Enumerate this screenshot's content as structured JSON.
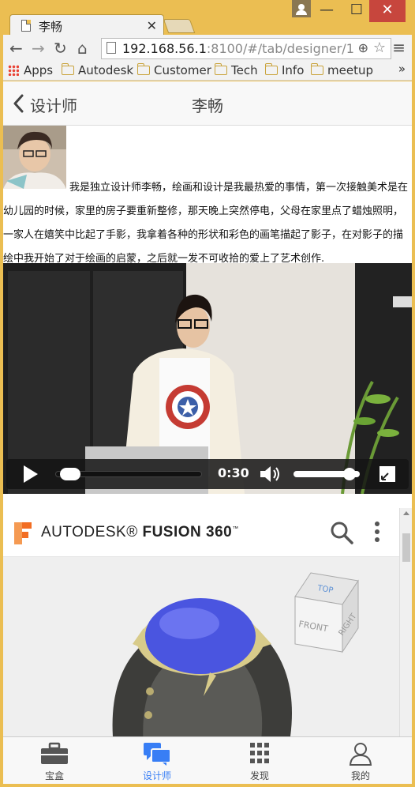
{
  "browser": {
    "tab_title": "李畅",
    "url_host": "192.168.56.1",
    "url_rest": ":8100/#/tab/designer/1",
    "window_controls": {
      "minimize": "—",
      "maximize": "☐",
      "close": "✕"
    },
    "bookmarks": [
      {
        "label": "Apps",
        "icon": "apps-grid-icon"
      },
      {
        "label": "Autodesk",
        "icon": "folder-icon"
      },
      {
        "label": "Customer",
        "icon": "folder-icon"
      },
      {
        "label": "Tech",
        "icon": "folder-icon"
      },
      {
        "label": "Info",
        "icon": "folder-icon"
      },
      {
        "label": "meetup",
        "icon": "folder-icon"
      }
    ],
    "bookmarks_more": "»"
  },
  "header": {
    "back_label": "设计师",
    "title": "李畅"
  },
  "designer": {
    "bio": "我是独立设计师李畅，绘画和设计是我最热爱的事情，第一次接触美术是在幼儿园的时候，家里的房子要重新整修，那天晚上突然停电，父母在家里点了蜡烛照明，一家人在嬉笑中比起了手影，我拿着各种的形状和彩色的画笔描起了影子，在对影子的描绘中我开始了对于绘画的启蒙，之后就一发不可收拾的爱上了艺术创作."
  },
  "video": {
    "time": "0:30",
    "progress": 0.04,
    "volume": 0.85
  },
  "embed": {
    "brand_prefix": "AUTODESK",
    "brand_product": "FUSION 360",
    "viewcube": {
      "top": "TOP",
      "front": "FRONT",
      "right": "RIGHT"
    }
  },
  "tabbar": {
    "items": [
      {
        "label": "宝盒",
        "icon": "briefcase-icon",
        "active": false
      },
      {
        "label": "设计师",
        "icon": "chat-icon",
        "active": true
      },
      {
        "label": "发现",
        "icon": "grid-icon",
        "active": false
      },
      {
        "label": "我的",
        "icon": "person-icon",
        "active": false
      }
    ],
    "active_color": "#387ef5"
  },
  "colors": {
    "window_frame": "#ebbe52",
    "close_button": "#c7463d",
    "fusion_orange": "#f26d22",
    "ring_gem": "#4a55e0",
    "ring_gold": "#d8cb8a"
  }
}
